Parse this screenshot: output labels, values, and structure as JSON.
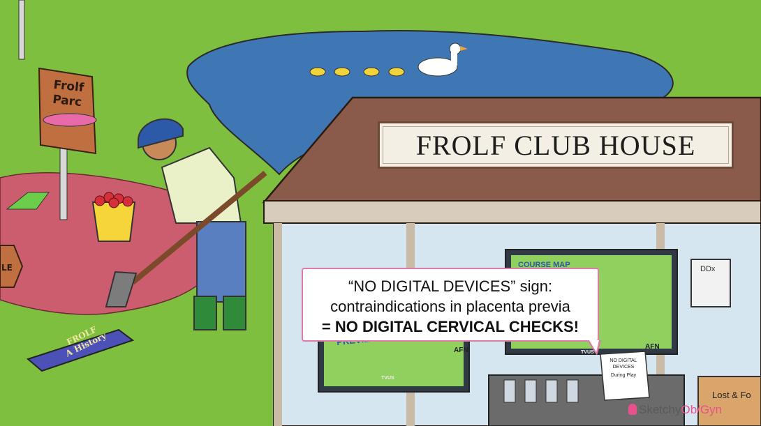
{
  "club_sign": {
    "text": "FROLF CLUB HOUSE"
  },
  "frolf_sign": {
    "line1": "Frolf",
    "line2": "Parc"
  },
  "hole_sign": {
    "text": "LE"
  },
  "book": {
    "line1": "FROLF",
    "line2": "A History"
  },
  "course_map": {
    "title": "COURSE MAP",
    "badge": "AFN",
    "brand": "TVUS"
  },
  "left_screen": {
    "text": "PREVIEW",
    "badge": "AFN",
    "brand": "TVUS"
  },
  "callout": {
    "line1": "“NO DIGITAL DEVICES” sign:",
    "line2": "contraindications in placenta previa",
    "line3": "= NO DIGITAL CERVICAL CHECKS!"
  },
  "desk_sign": {
    "line1": "NO DIGITAL",
    "line2": "DEVICES",
    "line3": "During Play"
  },
  "clipboard": {
    "text": "DDx"
  },
  "lost_found": {
    "text": "Lost & Fo"
  },
  "logo": {
    "part1": "Sketchy",
    "part2": "Ob/Gyn"
  },
  "colors": {
    "grass": "#7fbf3f",
    "pond": "#3f77b5",
    "roof": "#8a5a4b",
    "accent": "#e07aa8"
  }
}
